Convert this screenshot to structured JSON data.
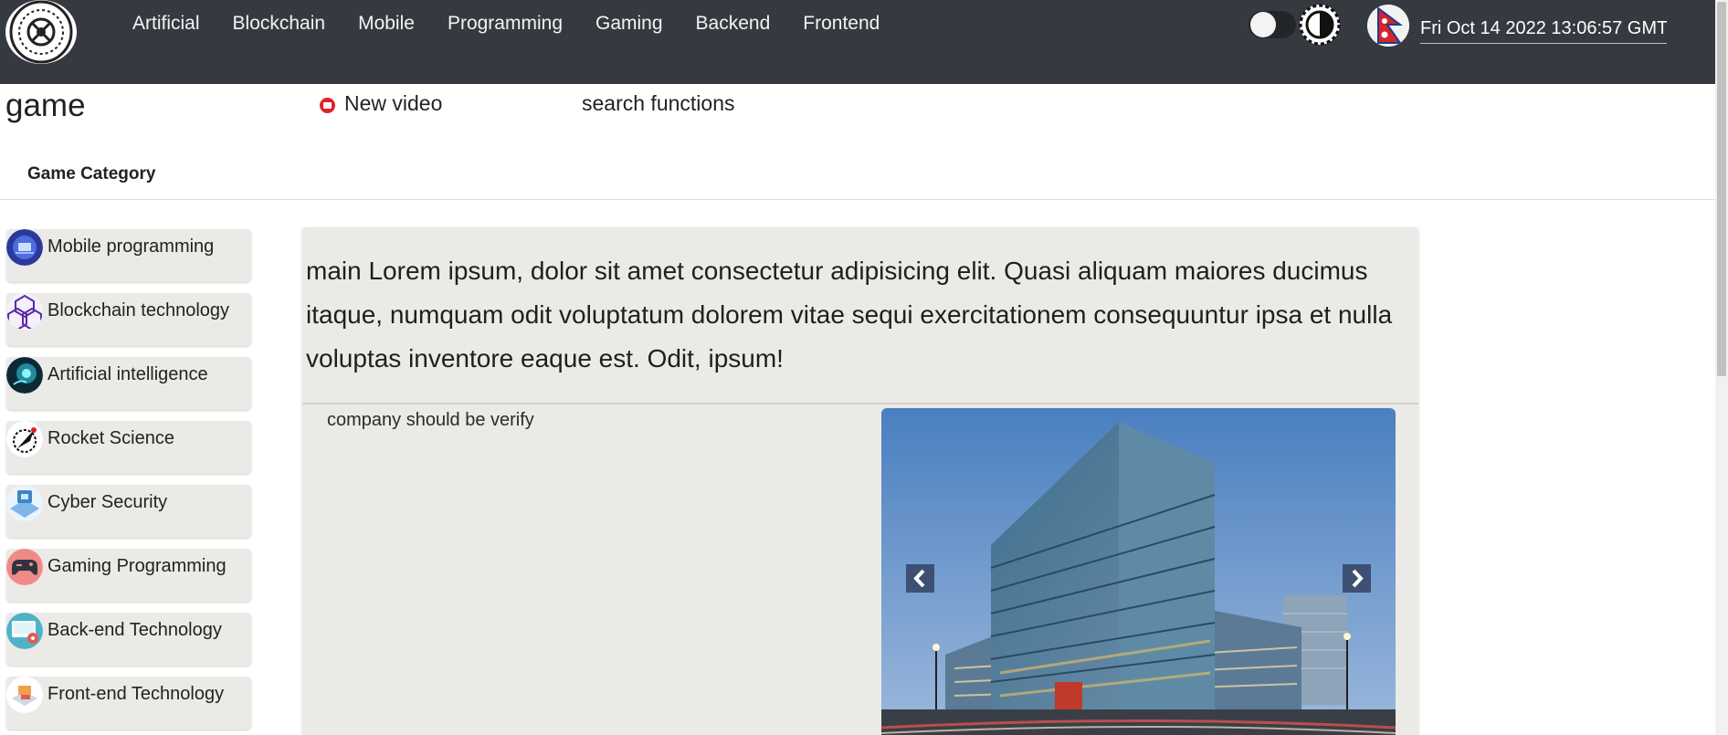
{
  "header": {
    "nav": [
      "Artificial",
      "Blockchain",
      "Mobile",
      "Programming",
      "Gaming",
      "Backend",
      "Frontend"
    ],
    "theme_toggle_icon": "toggle-switch",
    "contrast_icon": "contrast-icon",
    "flag_icon": "nepal-flag-icon",
    "datetime": "Fri Oct 14 2022 13:06:57 GMT"
  },
  "subheader": {
    "title": "game",
    "new_video": "New video",
    "search_functions": "search functions",
    "category_tab": "Game Category"
  },
  "sidebar": {
    "items": [
      {
        "label": "Mobile programming",
        "icon": "mobile-programming-icon"
      },
      {
        "label": "Blockchain technology",
        "icon": "blockchain-icon"
      },
      {
        "label": "Artificial intelligence",
        "icon": "ai-icon"
      },
      {
        "label": "Rocket Science",
        "icon": "rocket-icon"
      },
      {
        "label": "Cyber Security",
        "icon": "cyber-security-icon"
      },
      {
        "label": "Gaming Programming",
        "icon": "gamepad-icon"
      },
      {
        "label": "Back-end Technology",
        "icon": "backend-icon"
      },
      {
        "label": "Front-end Technology",
        "icon": "frontend-icon"
      }
    ]
  },
  "main": {
    "headline": "main Lorem ipsum, dolor sit amet consectetur adipisicing elit. Quasi aliquam maiores ducimus itaque, numquam odit voluptatum dolorem vitae sequi exercitationem consequuntur ipsa et nulla voluptas inventore eaque est. Odit, ipsum!",
    "note": "company should be verify",
    "carousel_image": "office-building-photo"
  },
  "colors": {
    "topbar": "#343a40",
    "card": "#eceae7",
    "accent_red": "#e0202a"
  }
}
